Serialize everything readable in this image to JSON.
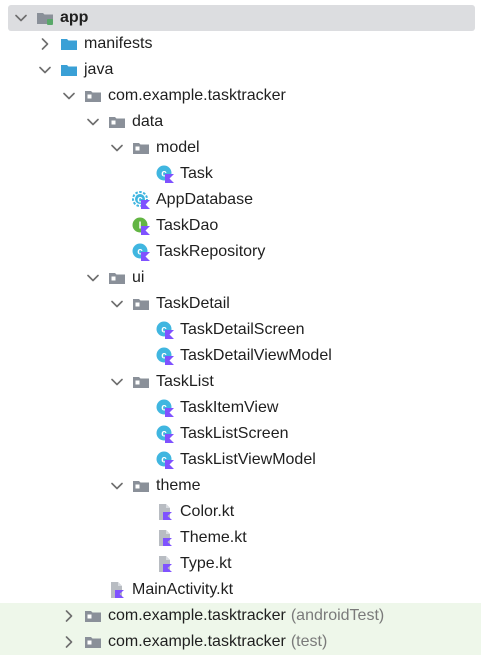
{
  "tree": [
    {
      "id": "app",
      "label": "app",
      "depth": 0,
      "chevron": "down",
      "icon": "module",
      "bold": true,
      "selected": true
    },
    {
      "id": "manifests",
      "label": "manifests",
      "depth": 1,
      "chevron": "right",
      "icon": "folder-blue"
    },
    {
      "id": "java",
      "label": "java",
      "depth": 1,
      "chevron": "down",
      "icon": "folder-blue"
    },
    {
      "id": "pkg-main",
      "label": "com.example.tasktracker",
      "depth": 2,
      "chevron": "down",
      "icon": "package"
    },
    {
      "id": "data",
      "label": "data",
      "depth": 3,
      "chevron": "down",
      "icon": "package"
    },
    {
      "id": "model",
      "label": "model",
      "depth": 4,
      "chevron": "down",
      "icon": "package"
    },
    {
      "id": "task",
      "label": "Task",
      "depth": 5,
      "chevron": "none",
      "icon": "kotlin-class"
    },
    {
      "id": "appdatabase",
      "label": "AppDatabase",
      "depth": 4,
      "chevron": "none",
      "icon": "kotlin-abstract"
    },
    {
      "id": "taskdao",
      "label": "TaskDao",
      "depth": 4,
      "chevron": "none",
      "icon": "kotlin-interface"
    },
    {
      "id": "taskrepository",
      "label": "TaskRepository",
      "depth": 4,
      "chevron": "none",
      "icon": "kotlin-class"
    },
    {
      "id": "ui",
      "label": "ui",
      "depth": 3,
      "chevron": "down",
      "icon": "package"
    },
    {
      "id": "taskdetail",
      "label": "TaskDetail",
      "depth": 4,
      "chevron": "down",
      "icon": "package"
    },
    {
      "id": "taskdetailscreen",
      "label": "TaskDetailScreen",
      "depth": 5,
      "chevron": "none",
      "icon": "kotlin-class"
    },
    {
      "id": "taskdetailviewmodel",
      "label": "TaskDetailViewModel",
      "depth": 5,
      "chevron": "none",
      "icon": "kotlin-class"
    },
    {
      "id": "tasklist",
      "label": "TaskList",
      "depth": 4,
      "chevron": "down",
      "icon": "package"
    },
    {
      "id": "taskitemview",
      "label": "TaskItemView",
      "depth": 5,
      "chevron": "none",
      "icon": "kotlin-class"
    },
    {
      "id": "tasklistscreen",
      "label": "TaskListScreen",
      "depth": 5,
      "chevron": "none",
      "icon": "kotlin-class"
    },
    {
      "id": "tasklistviewmodel",
      "label": "TaskListViewModel",
      "depth": 5,
      "chevron": "none",
      "icon": "kotlin-class"
    },
    {
      "id": "theme",
      "label": "theme",
      "depth": 4,
      "chevron": "down",
      "icon": "package"
    },
    {
      "id": "color-kt",
      "label": "Color.kt",
      "depth": 5,
      "chevron": "none",
      "icon": "kotlin-file"
    },
    {
      "id": "theme-kt",
      "label": "Theme.kt",
      "depth": 5,
      "chevron": "none",
      "icon": "kotlin-file"
    },
    {
      "id": "type-kt",
      "label": "Type.kt",
      "depth": 5,
      "chevron": "none",
      "icon": "kotlin-file"
    },
    {
      "id": "mainactivity-kt",
      "label": "MainActivity.kt",
      "depth": 3,
      "chevron": "none",
      "icon": "kotlin-file"
    },
    {
      "id": "pkg-androidtest",
      "label": "com.example.tasktracker",
      "suffix": "(androidTest)",
      "depth": 2,
      "chevron": "right",
      "icon": "package",
      "test": true
    },
    {
      "id": "pkg-test",
      "label": "com.example.tasktracker",
      "suffix": "(test)",
      "depth": 2,
      "chevron": "right",
      "icon": "package",
      "test": true
    }
  ],
  "colors": {
    "folder_blue": "#3aa0d6",
    "package_gray": "#8a9099",
    "kotlin_class": "#40b6e0",
    "kotlin_interface": "#62b543",
    "kotlin_purple": "#7f52ff",
    "module_green": "#59a869",
    "chevron": "#6e6e6e"
  }
}
